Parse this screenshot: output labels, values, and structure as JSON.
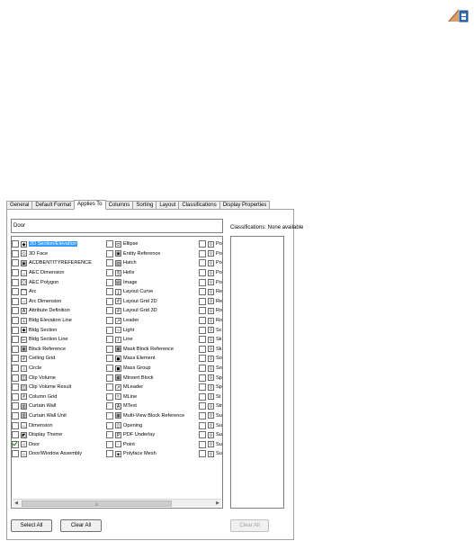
{
  "tabs": [
    {
      "label": "General",
      "active": false
    },
    {
      "label": "Default Format",
      "active": false
    },
    {
      "label": "Applies To",
      "active": true
    },
    {
      "label": "Columns",
      "active": false
    },
    {
      "label": "Sorting",
      "active": false
    },
    {
      "label": "Layout",
      "active": false
    },
    {
      "label": "Classifications",
      "active": false
    },
    {
      "label": "Display Properties",
      "active": false
    }
  ],
  "filter": {
    "value": "Door"
  },
  "objects": {
    "column1": [
      {
        "label": "2D Section/Elevation",
        "checked": false,
        "selected": true,
        "icon": "section-icon"
      },
      {
        "label": "3D Face",
        "checked": false,
        "icon": "face-icon"
      },
      {
        "label": "ACDBENTITYREFERENCE",
        "checked": false,
        "icon": "entity-icon"
      },
      {
        "label": "AEC Dimension",
        "checked": false,
        "icon": "dimension-icon"
      },
      {
        "label": "AEC Polygon",
        "checked": false,
        "icon": "polygon-icon"
      },
      {
        "label": "Arc",
        "checked": false,
        "icon": "arc-icon"
      },
      {
        "label": "Arc Dimension",
        "checked": false,
        "icon": "dimension-icon"
      },
      {
        "label": "Attribute Definition",
        "checked": false,
        "icon": "attribute-icon"
      },
      {
        "label": "Bldg Elevation Line",
        "checked": false,
        "icon": "elevation-icon"
      },
      {
        "label": "Bldg Section",
        "checked": false,
        "icon": "section-icon"
      },
      {
        "label": "Bldg Section Line",
        "checked": false,
        "icon": "section-line-icon"
      },
      {
        "label": "Block Reference",
        "checked": false,
        "icon": "block-icon"
      },
      {
        "label": "Ceiling Grid",
        "checked": false,
        "icon": "grid-icon"
      },
      {
        "label": "Circle",
        "checked": false,
        "icon": "circle-icon"
      },
      {
        "label": "Clip Volume",
        "checked": false,
        "icon": "clip-icon"
      },
      {
        "label": "Clip Volume Result",
        "checked": false,
        "icon": "clip-icon"
      },
      {
        "label": "Column Grid",
        "checked": false,
        "icon": "grid-icon"
      },
      {
        "label": "Curtain Wall",
        "checked": false,
        "icon": "wall-icon"
      },
      {
        "label": "Curtain Wall Unit",
        "checked": false,
        "icon": "wall-icon"
      },
      {
        "label": "Dimension",
        "checked": false,
        "icon": "dimension-icon"
      },
      {
        "label": "Display Theme",
        "checked": false,
        "icon": "theme-icon"
      },
      {
        "label": "Door",
        "checked": true,
        "icon": "door-icon"
      },
      {
        "label": "Door/Window Assembly",
        "checked": false,
        "icon": "door-icon"
      }
    ],
    "column2": [
      {
        "label": "Ellipse",
        "checked": false,
        "icon": "ellipse-icon"
      },
      {
        "label": "Entity Reference",
        "checked": false,
        "icon": "entity-icon"
      },
      {
        "label": "Hatch",
        "checked": false,
        "icon": "hatch-icon"
      },
      {
        "label": "Helix",
        "checked": false,
        "icon": "helix-icon"
      },
      {
        "label": "Image",
        "checked": false,
        "icon": "image-icon"
      },
      {
        "label": "Layout Curve",
        "checked": false,
        "icon": "curve-icon"
      },
      {
        "label": "Layout Grid 2D",
        "checked": false,
        "icon": "grid-icon"
      },
      {
        "label": "Layout Grid 3D",
        "checked": false,
        "icon": "grid-icon"
      },
      {
        "label": "Leader",
        "checked": false,
        "icon": "leader-icon"
      },
      {
        "label": "Light",
        "checked": false,
        "icon": "light-icon"
      },
      {
        "label": "Line",
        "checked": false,
        "icon": "line-icon"
      },
      {
        "label": "Mask Block Reference",
        "checked": false,
        "icon": "block-icon"
      },
      {
        "label": "Mass Element",
        "checked": false,
        "icon": "mass-icon"
      },
      {
        "label": "Mass Group",
        "checked": false,
        "icon": "mass-icon"
      },
      {
        "label": "Minsert Block",
        "checked": false,
        "icon": "block-icon"
      },
      {
        "label": "MLeader",
        "checked": false,
        "icon": "leader-icon"
      },
      {
        "label": "MLine",
        "checked": false,
        "icon": "mline-icon"
      },
      {
        "label": "MText",
        "checked": false,
        "icon": "text-icon"
      },
      {
        "label": "Multi-View Block Reference",
        "checked": false,
        "icon": "block-icon"
      },
      {
        "label": "Opening",
        "checked": false,
        "icon": "opening-icon"
      },
      {
        "label": "PDF Underlay",
        "checked": false,
        "icon": "pdf-icon"
      },
      {
        "label": "Point",
        "checked": false,
        "icon": "point-icon"
      },
      {
        "label": "Polyface Mesh",
        "checked": false,
        "icon": "mesh-icon"
      }
    ],
    "column3": [
      {
        "label": "Po",
        "checked": false
      },
      {
        "label": "Po",
        "checked": false
      },
      {
        "label": "Po",
        "checked": false
      },
      {
        "label": "Po",
        "checked": false
      },
      {
        "label": "Po",
        "checked": false
      },
      {
        "label": "Re",
        "checked": false
      },
      {
        "label": "Re",
        "checked": false
      },
      {
        "label": "Ro",
        "checked": false
      },
      {
        "label": "Ro",
        "checked": false
      },
      {
        "label": "Sc",
        "checked": false
      },
      {
        "label": "Sk",
        "checked": false
      },
      {
        "label": "Sk",
        "checked": false
      },
      {
        "label": "So",
        "checked": false
      },
      {
        "label": "So",
        "checked": false
      },
      {
        "label": "Sp",
        "checked": false
      },
      {
        "label": "Sp",
        "checked": false
      },
      {
        "label": "St",
        "checked": false
      },
      {
        "label": "Str",
        "checked": false
      },
      {
        "label": "Su",
        "checked": false
      },
      {
        "label": "Su",
        "checked": false
      },
      {
        "label": "Su",
        "checked": false
      },
      {
        "label": "Su",
        "checked": false
      },
      {
        "label": "Su",
        "checked": false
      }
    ]
  },
  "classifications": {
    "label": "Classifications: None available"
  },
  "buttons": {
    "select_all": "Select All",
    "clear_all": "Clear All",
    "clear_all_right": "Clear All"
  },
  "colors": {
    "selection": "#3399ff",
    "check": "#1a7a1a",
    "dialog_bg": "#f0f0f0"
  }
}
